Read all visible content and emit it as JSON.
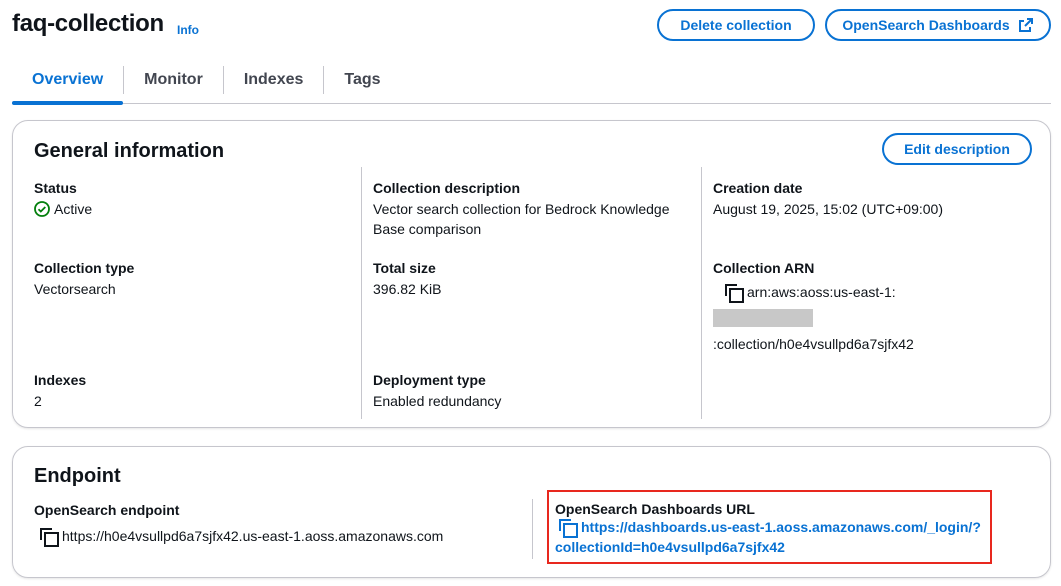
{
  "header": {
    "title": "faq-collection",
    "info": "Info",
    "delete_label": "Delete collection",
    "dashboards_label": "OpenSearch Dashboards"
  },
  "tabs": [
    "Overview",
    "Monitor",
    "Indexes",
    "Tags"
  ],
  "general": {
    "title": "General information",
    "edit_label": "Edit description",
    "status_label": "Status",
    "status_value": "Active",
    "desc_label": "Collection description",
    "desc_value": "Vector search collection for Bedrock Knowledge Base comparison",
    "created_label": "Creation date",
    "created_value": "August 19, 2025, 15:02 (UTC+09:00)",
    "type_label": "Collection type",
    "type_value": "Vectorsearch",
    "size_label": "Total size",
    "size_value": "396.82 KiB",
    "arn_label": "Collection ARN",
    "arn_prefix": "arn:aws:aoss:us-east-1:",
    "arn_suffix": ":collection/h0e4vsullpd6a7sjfx42",
    "indexes_label": "Indexes",
    "indexes_value": "2",
    "deploy_label": "Deployment type",
    "deploy_value": "Enabled redundancy"
  },
  "endpoint": {
    "title": "Endpoint",
    "os_label": "OpenSearch endpoint",
    "os_value": "https://h0e4vsullpd6a7sjfx42.us-east-1.aoss.amazonaws.com",
    "dash_label": "OpenSearch Dashboards URL",
    "dash_value": "https://dashboards.us-east-1.aoss.amazonaws.com/_login/?collectionId=h0e4vsullpd6a7sjfx42"
  },
  "colors": {
    "accent": "#0972d3",
    "success": "#037f0c",
    "highlight": "#e8281e"
  }
}
